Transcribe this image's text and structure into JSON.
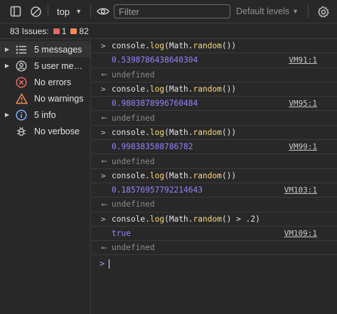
{
  "toolbar": {
    "context": "top",
    "filter_placeholder": "Filter",
    "levels": "Default levels"
  },
  "issues": {
    "label": "83 Issues:",
    "errors": "1",
    "warnings": "82"
  },
  "sidebar": {
    "items": [
      {
        "label": "5 messages",
        "icon": "list-icon",
        "expandable": true
      },
      {
        "label": "5 user me…",
        "icon": "user-icon",
        "expandable": true
      },
      {
        "label": "No errors",
        "icon": "error-icon",
        "expandable": false
      },
      {
        "label": "No warnings",
        "icon": "warning-icon",
        "expandable": false
      },
      {
        "label": "5 info",
        "icon": "info-icon",
        "expandable": true
      },
      {
        "label": "No verbose",
        "icon": "bug-icon",
        "expandable": false
      }
    ]
  },
  "console": {
    "entries": [
      {
        "input_pre": "console.",
        "input_fn1": "log",
        "input_mid": "(Math.",
        "input_fn2": "random",
        "input_post": "())",
        "output": "0.5398786438640304",
        "source": "VM91:1"
      },
      {
        "input_pre": "console.",
        "input_fn1": "log",
        "input_mid": "(Math.",
        "input_fn2": "random",
        "input_post": "())",
        "output": "0.9803878996760484",
        "source": "VM95:1"
      },
      {
        "input_pre": "console.",
        "input_fn1": "log",
        "input_mid": "(Math.",
        "input_fn2": "random",
        "input_post": "())",
        "output": "0.998383588786782",
        "source": "VM99:1"
      },
      {
        "input_pre": "console.",
        "input_fn1": "log",
        "input_mid": "(Math.",
        "input_fn2": "random",
        "input_post": "())",
        "output": "0.18576957792214643",
        "source": "VM103:1"
      },
      {
        "input_pre": "console.",
        "input_fn1": "log",
        "input_mid": "(Math.",
        "input_fn2": "random",
        "input_post": "() > .2)",
        "output": "true",
        "source": "VM109:1"
      }
    ],
    "undefined_text": "undefined"
  },
  "colors": {
    "background": "#282828",
    "number": "#9980ff",
    "function": "#f9d97b",
    "error": "#e46962",
    "warning": "#f28b54",
    "prompt": "#7cacf8"
  }
}
